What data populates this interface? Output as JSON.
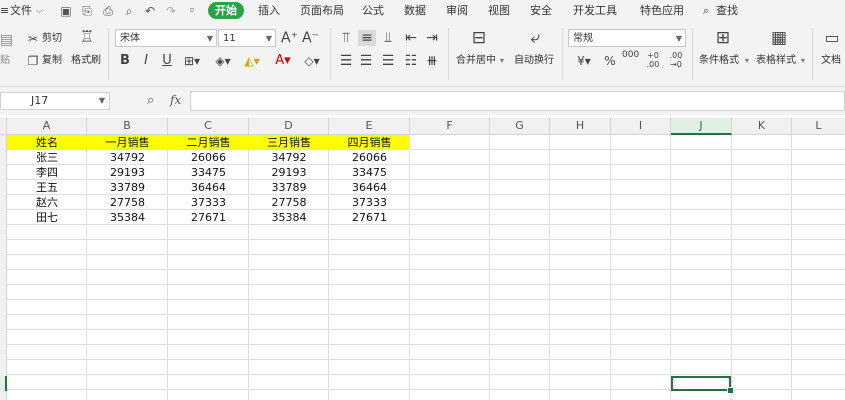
{
  "menu": {
    "file": "文件",
    "tabs": [
      "开始",
      "插入",
      "页面布局",
      "公式",
      "数据",
      "审阅",
      "视图",
      "安全",
      "开发工具",
      "特色应用"
    ],
    "search": "查找"
  },
  "ribbon": {
    "cut": "剪切",
    "paste": "贴",
    "copy": "复制",
    "format_painter": "格式刷",
    "font_name": "宋体",
    "font_size": "11",
    "merge_center": "合并居中",
    "wrap_text": "自动换行",
    "number_format": "常规",
    "conditional_format": "条件格式",
    "table_style": "表格样式",
    "doc_helper": "文档"
  },
  "formula_bar": {
    "name_box": "J17",
    "fx": "fx",
    "value": ""
  },
  "columns": [
    "A",
    "B",
    "C",
    "D",
    "E",
    "F",
    "G",
    "H",
    "I",
    "J",
    "K",
    "L"
  ],
  "selected_column": "J",
  "sheet": {
    "header": [
      "姓名",
      "一月销售",
      "二月销售",
      "三月销售",
      "四月销售"
    ],
    "header_fill": "#ffff00",
    "rows": [
      [
        "张三",
        "34792",
        "26066",
        "34792",
        "26066"
      ],
      [
        "李四",
        "29193",
        "33475",
        "29193",
        "33475"
      ],
      [
        "王五",
        "33789",
        "36464",
        "33789",
        "36464"
      ],
      [
        "赵六",
        "27758",
        "37333",
        "27758",
        "37333"
      ],
      [
        "田七",
        "35384",
        "27671",
        "35384",
        "27671"
      ]
    ]
  },
  "colors": {
    "accent": "#2aa248",
    "selection": "#217346"
  }
}
